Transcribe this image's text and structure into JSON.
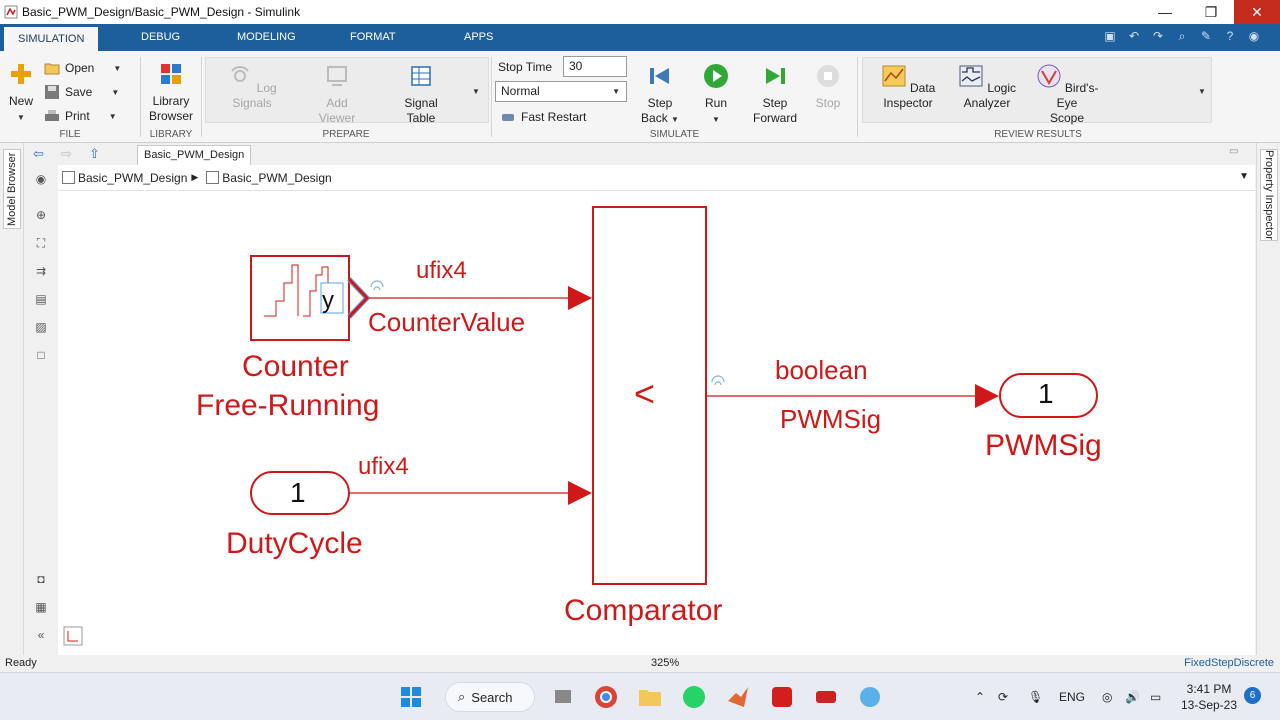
{
  "window": {
    "title": "Basic_PWM_Design/Basic_PWM_Design - Simulink",
    "minimize": "—",
    "maximize": "❐",
    "close": "✕"
  },
  "tabs": [
    {
      "label": "SIMULATION"
    },
    {
      "label": "DEBUG"
    },
    {
      "label": "MODELING"
    },
    {
      "label": "FORMAT"
    },
    {
      "label": "APPS"
    }
  ],
  "ribbon": {
    "file": {
      "label": "FILE",
      "new": "New",
      "open": "Open",
      "save": "Save",
      "print": "Print"
    },
    "library": {
      "label": "LIBRARY",
      "library_browser_1": "Library",
      "library_browser_2": "Browser"
    },
    "prepare": {
      "label": "PREPARE",
      "log_signals_1": "Log",
      "log_signals_2": "Signals",
      "add_viewer_1": "Add",
      "add_viewer_2": "Viewer",
      "signal_table_1": "Signal",
      "signal_table_2": "Table"
    },
    "simulate": {
      "label": "SIMULATE",
      "stop_time_label": "Stop Time",
      "stop_time_value": "30",
      "mode_value": "Normal",
      "fast_restart": "Fast Restart",
      "step_back_1": "Step",
      "step_back_2": "Back",
      "run": "Run",
      "step_forward_1": "Step",
      "step_forward_2": "Forward",
      "stop": "Stop"
    },
    "review": {
      "label": "REVIEW RESULTS",
      "data_inspector_1": "Data",
      "data_inspector_2": "Inspector",
      "logic_analyzer_1": "Logic",
      "logic_analyzer_2": "Analyzer",
      "birds_eye_1": "Bird's-Eye",
      "birds_eye_2": "Scope"
    }
  },
  "side_panels": {
    "left": "Model Browser",
    "right": "Property Inspector"
  },
  "nav": {
    "model_tab": "Basic_PWM_Design",
    "breadcrumb": [
      "Basic_PWM_Design",
      "Basic_PWM_Design"
    ]
  },
  "diagram": {
    "counter_block_output": "y",
    "counter_label_1": "Counter",
    "counter_label_2": "Free-Running",
    "counter_type": "ufix4",
    "counter_signal": "CounterValue",
    "duty_port_number": "1",
    "duty_label": "DutyCycle",
    "duty_type": "ufix4",
    "comparator_operator": "<",
    "comparator_label": "Comparator",
    "out_type": "boolean",
    "out_signal": "PWMSig",
    "out_port_number": "1",
    "out_port_label": "PWMSig"
  },
  "status": {
    "state": "Ready",
    "zoom": "325%",
    "solver": "FixedStepDiscrete"
  },
  "taskbar": {
    "search": "Search",
    "language": "ENG",
    "time": "3:41 PM",
    "date": "13-Sep-23",
    "notifications": "6"
  },
  "colors": {
    "ribbon_tab_bg": "#1d5e9c",
    "diagram_red": "#d01818",
    "signal_highlight": "#5aa5e6"
  }
}
